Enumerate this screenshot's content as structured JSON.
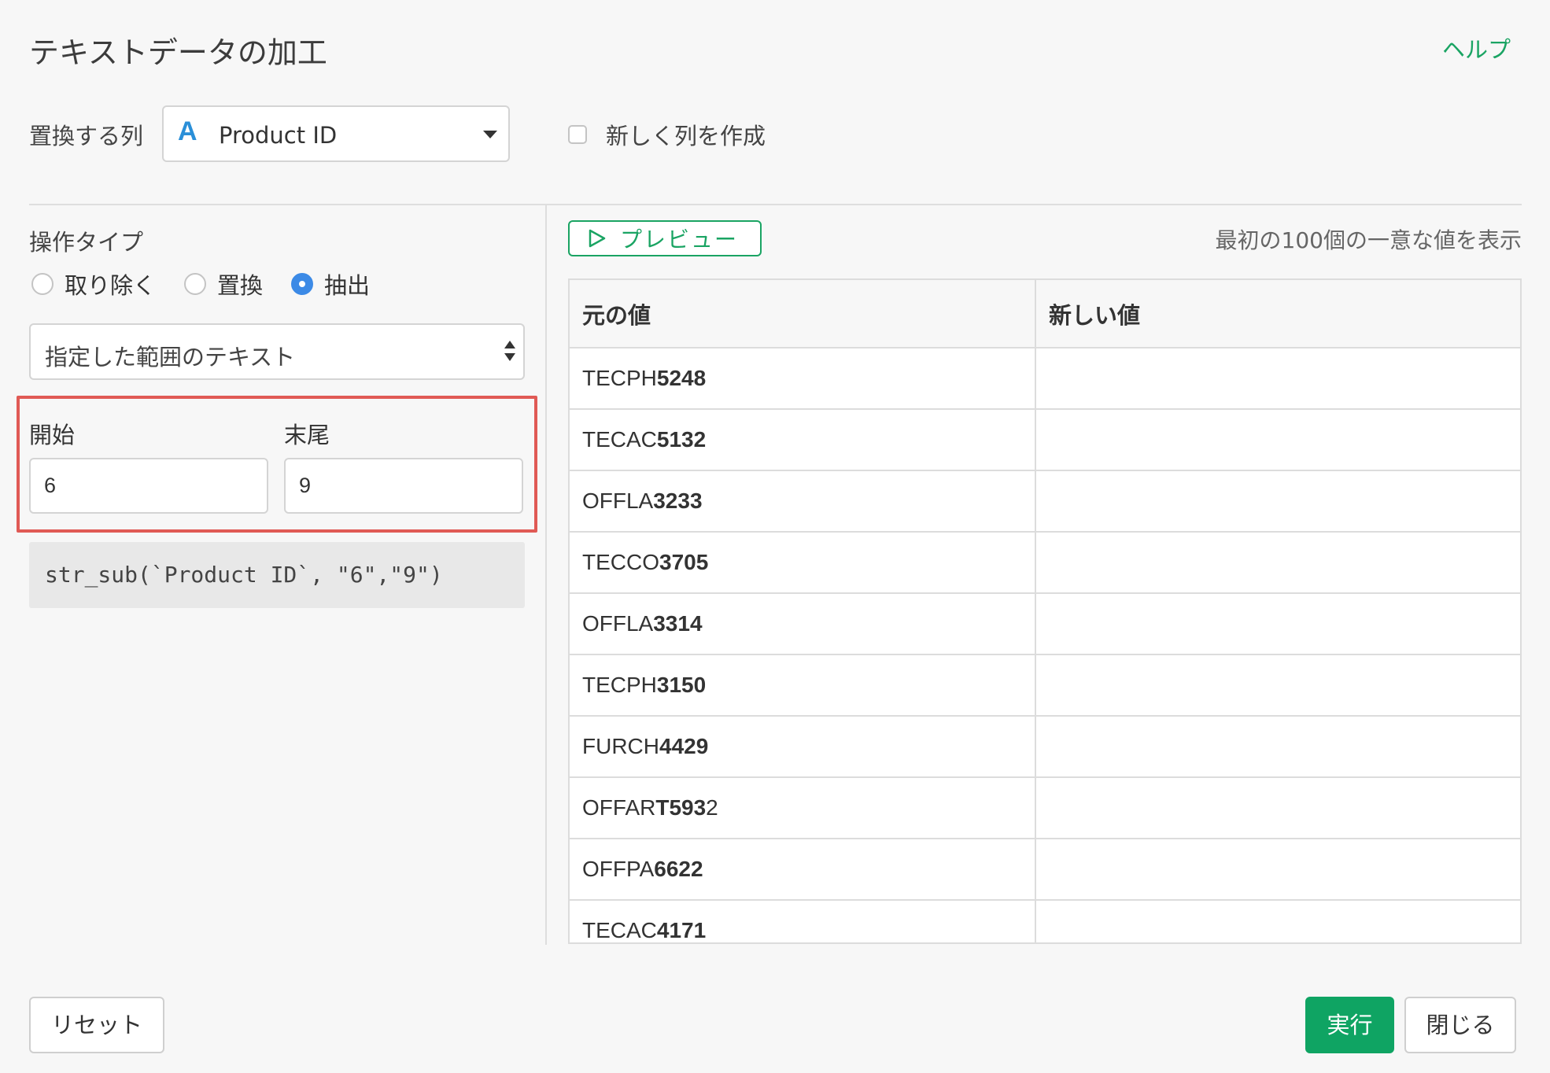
{
  "dialog": {
    "title": "テキストデータの加工",
    "help_label": "ヘルプ"
  },
  "column": {
    "label": "置換する列",
    "type_icon": "A",
    "selected": "Product ID",
    "new_column_label": "新しく列を作成",
    "new_column_checked": false
  },
  "operation": {
    "label": "操作タイプ",
    "options": [
      "取り除く",
      "置換",
      "抽出"
    ],
    "selected": "抽出",
    "mode": "指定した範囲のテキスト",
    "start_label": "開始",
    "start_value": "6",
    "end_label": "末尾",
    "end_value": "9",
    "code": "str_sub(`Product ID`, \"6\",\"9\")"
  },
  "preview": {
    "button_label": "プレビュー",
    "note": "最初の100個の一意な値を表示",
    "headers": [
      "元の値",
      "新しい値"
    ],
    "rows": [
      {
        "prefix": "TECPH",
        "bold": "5248",
        "suffix": "",
        "new": ""
      },
      {
        "prefix": "TECAC",
        "bold": "5132",
        "suffix": "",
        "new": ""
      },
      {
        "prefix": "OFFLA",
        "bold": "3233",
        "suffix": "",
        "new": ""
      },
      {
        "prefix": "TECCO",
        "bold": "3705",
        "suffix": "",
        "new": ""
      },
      {
        "prefix": "OFFLA",
        "bold": "3314",
        "suffix": "",
        "new": ""
      },
      {
        "prefix": "TECPH",
        "bold": "3150",
        "suffix": "",
        "new": ""
      },
      {
        "prefix": "FURCH",
        "bold": "4429",
        "suffix": "",
        "new": ""
      },
      {
        "prefix": "OFFAR",
        "bold": "T593",
        "suffix": "2",
        "new": ""
      },
      {
        "prefix": "OFFPA",
        "bold": "6622",
        "suffix": "",
        "new": ""
      },
      {
        "prefix": "TECAC",
        "bold": "4171",
        "suffix": "",
        "new": ""
      }
    ]
  },
  "footer": {
    "reset_label": "リセット",
    "run_label": "実行",
    "close_label": "閉じる"
  },
  "colors": {
    "accent_green": "#0fa463",
    "radio_blue": "#3c8ae6",
    "highlight_red": "#e05a55"
  }
}
